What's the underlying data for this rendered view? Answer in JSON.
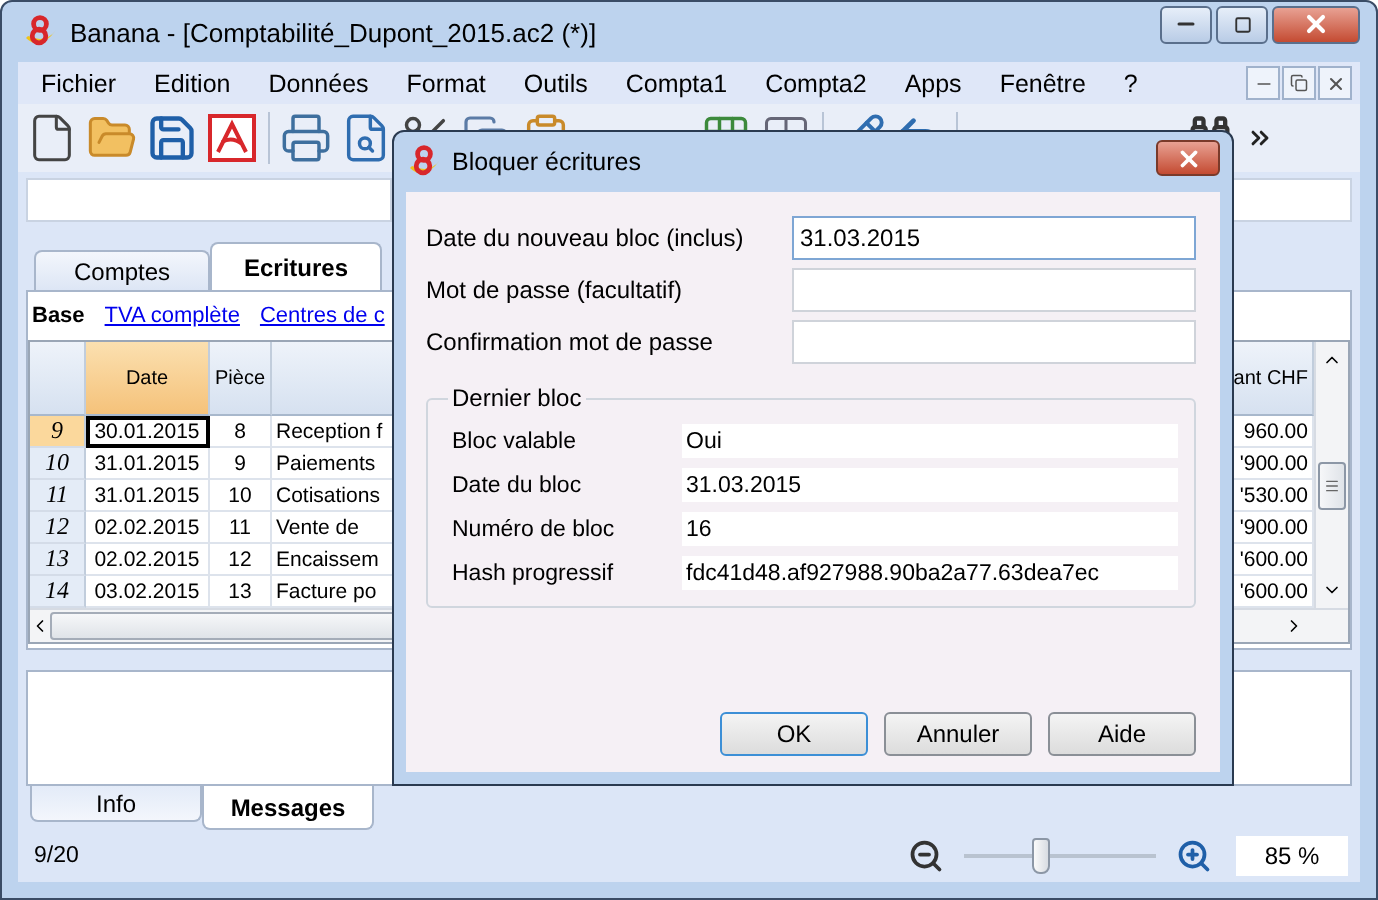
{
  "window": {
    "title": "Banana - [Comptabilité_Dupont_2015.ac2 (*)]"
  },
  "menu": [
    "Fichier",
    "Edition",
    "Données",
    "Format",
    "Outils",
    "Compta1",
    "Compta2",
    "Apps",
    "Fenêtre",
    "?"
  ],
  "tabs": [
    {
      "label": "Comptes",
      "selected": false
    },
    {
      "label": "Ecritures",
      "selected": true
    }
  ],
  "views": [
    {
      "label": "Base",
      "selected": true
    },
    {
      "label": "TVA complète",
      "selected": false
    },
    {
      "label": "Centres de c",
      "selected": false
    }
  ],
  "table": {
    "columns": [
      {
        "label": "Date",
        "selected": true
      },
      {
        "label": "Pièce",
        "selected": false
      },
      {
        "label": "ant CHF",
        "selected": false
      }
    ],
    "rows": [
      {
        "number": "9",
        "date": "30.01.2015",
        "piece": "8",
        "description": "Reception f",
        "amount": "960.00",
        "selected": true
      },
      {
        "number": "10",
        "date": "31.01.2015",
        "piece": "9",
        "description": "Paiements",
        "amount": "'900.00",
        "selected": false
      },
      {
        "number": "11",
        "date": "31.01.2015",
        "piece": "10",
        "description": "Cotisations",
        "amount": "'530.00",
        "selected": false
      },
      {
        "number": "12",
        "date": "02.02.2015",
        "piece": "11",
        "description": "Vente de",
        "amount": "'900.00",
        "selected": false
      },
      {
        "number": "13",
        "date": "02.02.2015",
        "piece": "12",
        "description": "Encaissem",
        "amount": "'600.00",
        "selected": false
      },
      {
        "number": "14",
        "date": "03.02.2015",
        "piece": "13",
        "description": "Facture po",
        "amount": "'600.00",
        "selected": false
      }
    ]
  },
  "bottom_tabs": [
    {
      "label": "Info",
      "selected": false
    },
    {
      "label": "Messages",
      "selected": true
    }
  ],
  "status_bar": {
    "position": "9/20",
    "zoom": "85 %"
  },
  "zoom_slider": {
    "level": 0.4
  },
  "dialog": {
    "title": "Bloquer écritures",
    "fields": [
      {
        "label": "Date du nouveau bloc (inclus)",
        "value": "31.03.2015"
      },
      {
        "label": "Mot de passe (facultatif)"
      },
      {
        "label": "Confirmation mot de passe"
      }
    ],
    "group": {
      "title": "Dernier bloc",
      "rows": [
        {
          "label": "Bloc valable",
          "value": "Oui"
        },
        {
          "label": "Date du bloc",
          "value": "31.03.2015"
        },
        {
          "label": "Numéro de bloc",
          "value": "16"
        },
        {
          "label": "Hash progressif",
          "value": "fdc41d48.af927988.90ba2a77.63dea7ec"
        }
      ]
    },
    "buttons": [
      {
        "label": "OK",
        "default": true
      },
      {
        "label": "Annuler",
        "default": false
      },
      {
        "label": "Aide",
        "default": false
      }
    ]
  }
}
